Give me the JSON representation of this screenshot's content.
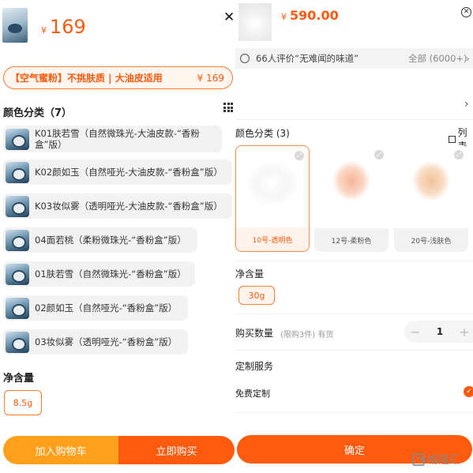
{
  "left": {
    "price_symbol": "¥",
    "price": "169",
    "close": "✕",
    "promo": {
      "text": "【空气蜜粉】不挑肤质 | 大油皮适用",
      "price": "¥ 169"
    },
    "color_title": "颜色分类（7）",
    "variants": [
      "K01肤若雪（自然微珠光-大油皮款-“香粉盒”版）",
      "K02颜如玉（自然哑光-大油皮款-“香粉盒”版）",
      "K03妆似雾（透明哑光-大油皮款-“香粉盒”版）",
      "04面若桃（柔粉微珠光-“香粉盒”版）",
      "01肤若雪（自然微珠光-“香粉盒”版）",
      "02颜如玉（自然哑光-“香粉盒”版）",
      "03妆似雾（透明哑光-“香粉盒”版）"
    ],
    "net_title": "净含量",
    "size": "8.5g",
    "add_cart": "加入购物车",
    "buy_now": "立即购买"
  },
  "right": {
    "price_symbol": "¥",
    "price": "590.00",
    "close": "✕",
    "review": {
      "text": "66人评价“无难闻的味道”",
      "all": "全部 (6000+)",
      "arrow": "›"
    },
    "blank_arrow": "›",
    "color_title": "颜色分类 (3)",
    "list_toggle": "列表",
    "shades": [
      {
        "label": "10号-透明色",
        "selected": true,
        "color": "#f4f4f4"
      },
      {
        "label": "12号-柔粉色",
        "selected": false,
        "color": "#f7c3a8"
      },
      {
        "label": "20号-浅肤色",
        "selected": false,
        "color": "#f3caa5"
      }
    ],
    "net_title": "净含量",
    "size": "30g",
    "qty_label": "购买数量",
    "qty_hint": "(限购3件) 有货",
    "qty": "1",
    "qty_minus": "−",
    "qty_plus": "+",
    "custom_title": "定制服务",
    "custom_option": "免费定制",
    "confirm": "确定"
  },
  "watermark": "格隆汇",
  "colors": {
    "accent": "#ff5a0e",
    "accent_light": "#ff9f1a",
    "border": "#ff7a33"
  }
}
